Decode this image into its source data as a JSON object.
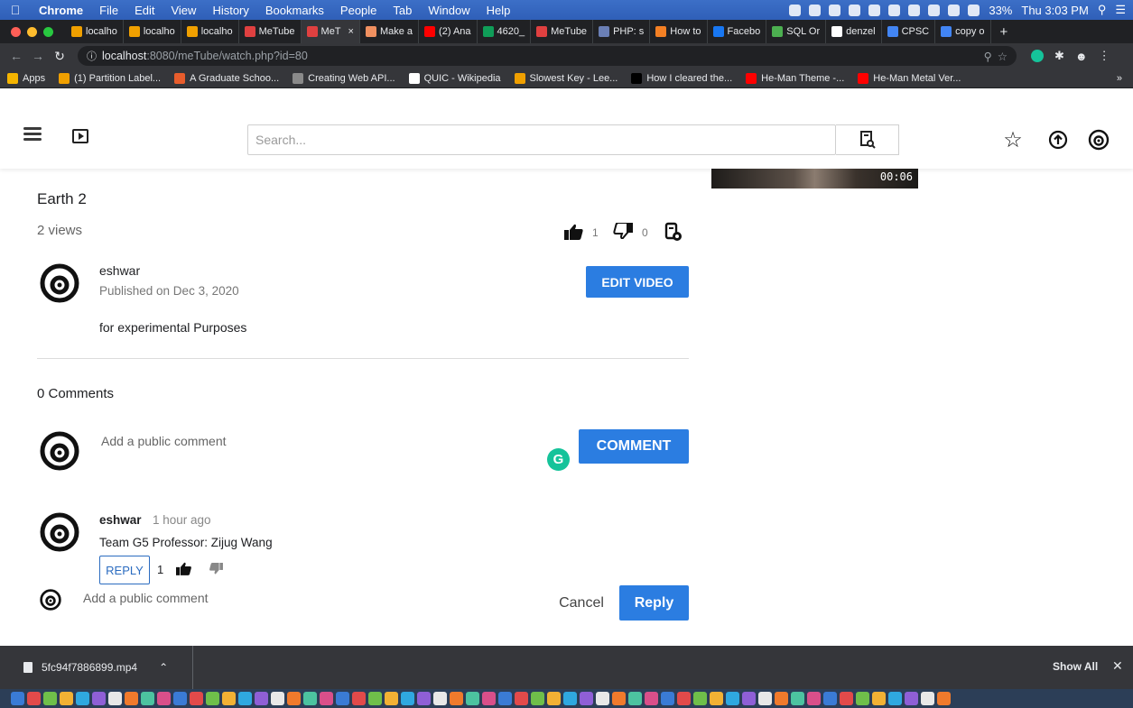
{
  "menubar": {
    "app": "Chrome",
    "items": [
      "File",
      "Edit",
      "View",
      "History",
      "Bookmarks",
      "People",
      "Tab",
      "Window",
      "Help"
    ],
    "battery": "33%",
    "clock": "Thu 3:03 PM"
  },
  "tabs": [
    {
      "label": "localho",
      "color": "#f0a000"
    },
    {
      "label": "localho",
      "color": "#f0a000"
    },
    {
      "label": "localho",
      "color": "#f0a000"
    },
    {
      "label": "MeTube",
      "color": "#e04040"
    },
    {
      "label": "MeT",
      "color": "#e04040",
      "active": true
    },
    {
      "label": "Make a",
      "color": "#f09060"
    },
    {
      "label": "(2) Ana",
      "color": "#ff0000"
    },
    {
      "label": "4620_",
      "color": "#0f9d58"
    },
    {
      "label": "MeTube",
      "color": "#e04040"
    },
    {
      "label": "PHP: s",
      "color": "#6a7fb5"
    },
    {
      "label": "How to",
      "color": "#f48024"
    },
    {
      "label": "Facebo",
      "color": "#1877f2"
    },
    {
      "label": "SQL Or",
      "color": "#4caf50"
    },
    {
      "label": "denzel",
      "color": "#ffffff"
    },
    {
      "label": "CPSC",
      "color": "#4285f4"
    },
    {
      "label": "copy o",
      "color": "#4285f4"
    }
  ],
  "address": {
    "host": "localhost",
    "path": ":8080/meTube/watch.php?id=80"
  },
  "bookmarks": [
    {
      "label": "Apps",
      "color": "#f4b400"
    },
    {
      "label": "(1) Partition Label...",
      "color": "#f0a000"
    },
    {
      "label": "A Graduate Schoo...",
      "color": "#e85d2c"
    },
    {
      "label": "Creating Web API...",
      "color": "#8a8a8a"
    },
    {
      "label": "QUIC - Wikipedia",
      "color": "#ffffff"
    },
    {
      "label": "Slowest Key - Lee...",
      "color": "#f0a000"
    },
    {
      "label": "How I cleared the...",
      "color": "#000000"
    },
    {
      "label": "He-Man Theme -...",
      "color": "#ff0000"
    },
    {
      "label": "He-Man Metal Ver...",
      "color": "#ff0000"
    }
  ],
  "header": {
    "search_placeholder": "Search..."
  },
  "thumbnail": {
    "duration": "00:06"
  },
  "video": {
    "title": "Earth 2",
    "views": "2 views",
    "likes": "1",
    "dislikes": "0",
    "uploader": "eshwar",
    "published": "Published on Dec 3, 2020",
    "edit_label": "EDIT VIDEO",
    "description": "for experimental Purposes"
  },
  "comments": {
    "count_label": "0 Comments",
    "input_placeholder": "Add a public comment",
    "submit_label": "COMMENT",
    "items": [
      {
        "author": "eshwar",
        "time": "1 hour ago",
        "text": "Team G5 Professor: Zijug Wang",
        "reply_label": "REPLY",
        "likes": "1"
      }
    ],
    "reply_placeholder": "Add a public comment",
    "cancel_label": "Cancel",
    "reply_submit_label": "Reply"
  },
  "downloads": {
    "file": "5fc94f7886899.mp4",
    "show_all": "Show All"
  },
  "colors": {
    "accent": "#2b7de1",
    "chrome_dark": "#35363a"
  }
}
